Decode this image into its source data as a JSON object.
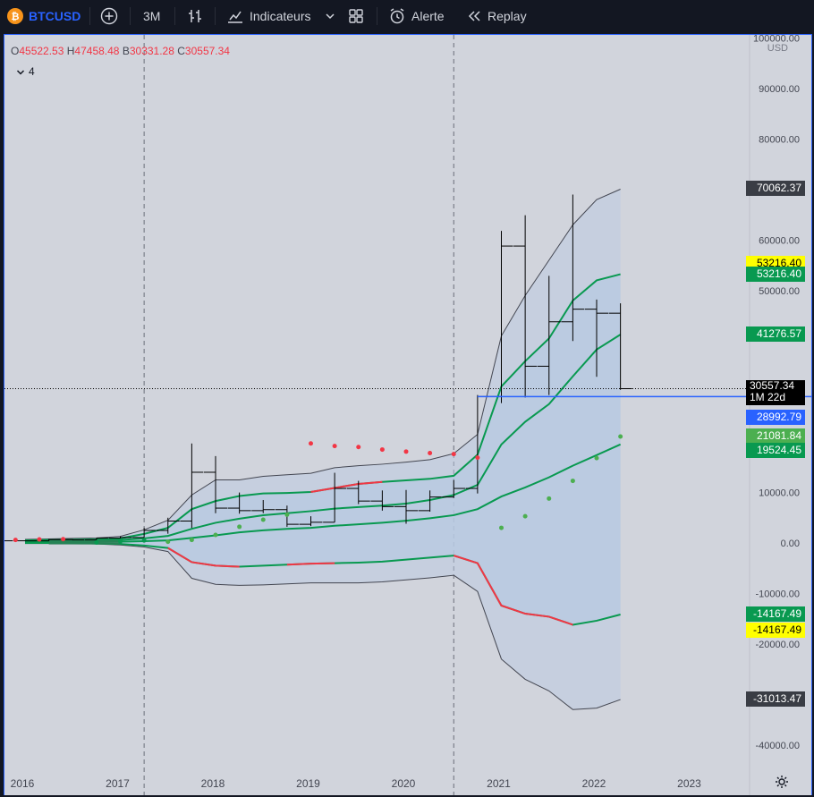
{
  "toolbar": {
    "symbol": "BTCUSD",
    "interval": "3M",
    "indicators_label": "Indicateurs",
    "alert_label": "Alerte",
    "replay_label": "Replay",
    "colors": {
      "bg": "#131722",
      "text": "#d1d4dc",
      "bitcoin": "#f7931a",
      "symbol_text": "#2962ff"
    }
  },
  "legend": {
    "open_key": "O",
    "open": "45522.53",
    "high_key": "H",
    "high": "47458.48",
    "low_key": "B",
    "low": "30331.28",
    "close_key": "C",
    "close": "30557.34",
    "indicators_count": "4"
  },
  "price_axis": {
    "currency": "USD",
    "ticks": [
      {
        "label": "100000.00",
        "v": 100000
      },
      {
        "label": "90000.00",
        "v": 90000
      },
      {
        "label": "80000.00",
        "v": 80000
      },
      {
        "label": "60000.00",
        "v": 60000
      },
      {
        "label": "50000.00",
        "v": 50000
      },
      {
        "label": "10000.00",
        "v": 10000
      },
      {
        "label": "0.00",
        "v": 0
      },
      {
        "label": "-10000.00",
        "v": -10000
      },
      {
        "label": "-20000.00",
        "v": -20000
      },
      {
        "label": "-40000.00",
        "v": -40000
      }
    ],
    "labels": [
      {
        "text": "70062.37",
        "v": 70062.37,
        "bg": "#3a3d45",
        "fg": "#ffffff"
      },
      {
        "text": "53216.40",
        "v": 55200,
        "bg": "#ffff00",
        "fg": "#000000"
      },
      {
        "text": "53216.40",
        "v": 53216.4,
        "bg": "#089950",
        "fg": "#ffffff"
      },
      {
        "text": "41276.57",
        "v": 41276.57,
        "bg": "#089950",
        "fg": "#ffffff"
      },
      {
        "text": "30557.34",
        "v": 30557.34,
        "bg": "#000000",
        "fg": "#ffffff",
        "sub": "1M 22d"
      },
      {
        "text": "28992.79",
        "v": 24800,
        "bg": "#2962ff",
        "fg": "#ffffff"
      },
      {
        "text": "21081.84",
        "v": 21081.84,
        "bg": "#4caf50",
        "fg": "#ffffff"
      },
      {
        "text": "19524.45",
        "v": 18300,
        "bg": "#089950",
        "fg": "#ffffff"
      },
      {
        "text": "-14167.49",
        "v": -14167.49,
        "bg": "#089950",
        "fg": "#ffffff"
      },
      {
        "text": "-14167.49",
        "v": -17300,
        "bg": "#ffff00",
        "fg": "#000000"
      },
      {
        "text": "-31013.47",
        "v": -31013.47,
        "bg": "#3a3d45",
        "fg": "#ffffff"
      }
    ]
  },
  "time_axis": {
    "labels": [
      "2016",
      "2017",
      "2018",
      "2019",
      "2020",
      "2021",
      "2022",
      "2023"
    ]
  },
  "chart_data": {
    "type": "ohlc",
    "interval": "3M",
    "ohlc": [
      {
        "t": 2015.75,
        "o": 230,
        "h": 470,
        "l": 200,
        "c": 430
      },
      {
        "t": 2016.0,
        "o": 430,
        "h": 460,
        "l": 360,
        "c": 415
      },
      {
        "t": 2016.25,
        "o": 415,
        "h": 780,
        "l": 410,
        "c": 670
      },
      {
        "t": 2016.5,
        "o": 670,
        "h": 730,
        "l": 520,
        "c": 610
      },
      {
        "t": 2016.75,
        "o": 610,
        "h": 980,
        "l": 600,
        "c": 960
      },
      {
        "t": 2017.0,
        "o": 960,
        "h": 1300,
        "l": 890,
        "c": 1080
      },
      {
        "t": 2017.25,
        "o": 1080,
        "h": 2980,
        "l": 1080,
        "c": 2480
      },
      {
        "t": 2017.5,
        "o": 2480,
        "h": 5000,
        "l": 1830,
        "c": 4340
      },
      {
        "t": 2017.75,
        "o": 4340,
        "h": 19700,
        "l": 2970,
        "c": 14000
      },
      {
        "t": 2018.0,
        "o": 14000,
        "h": 17200,
        "l": 5900,
        "c": 6900
      },
      {
        "t": 2018.25,
        "o": 6900,
        "h": 9990,
        "l": 5800,
        "c": 6400
      },
      {
        "t": 2018.5,
        "o": 6400,
        "h": 8500,
        "l": 5900,
        "c": 6600
      },
      {
        "t": 2018.75,
        "o": 6600,
        "h": 7400,
        "l": 3200,
        "c": 3700
      },
      {
        "t": 2019.0,
        "o": 3700,
        "h": 5300,
        "l": 3350,
        "c": 4100
      },
      {
        "t": 2019.25,
        "o": 4100,
        "h": 13900,
        "l": 4100,
        "c": 10800
      },
      {
        "t": 2019.5,
        "o": 10800,
        "h": 12300,
        "l": 7700,
        "c": 8300
      },
      {
        "t": 2019.75,
        "o": 8300,
        "h": 10400,
        "l": 6400,
        "c": 7200
      },
      {
        "t": 2020.0,
        "o": 7200,
        "h": 10500,
        "l": 3800,
        "c": 6400
      },
      {
        "t": 2020.25,
        "o": 6400,
        "h": 10400,
        "l": 6200,
        "c": 9100
      },
      {
        "t": 2020.5,
        "o": 9100,
        "h": 12500,
        "l": 8900,
        "c": 10800
      },
      {
        "t": 2020.75,
        "o": 10800,
        "h": 29300,
        "l": 9800,
        "c": 29000
      },
      {
        "t": 2021.0,
        "o": 29000,
        "h": 61800,
        "l": 27700,
        "c": 58800
      },
      {
        "t": 2021.25,
        "o": 58800,
        "h": 64900,
        "l": 28800,
        "c": 35000
      },
      {
        "t": 2021.5,
        "o": 35000,
        "h": 52900,
        "l": 29300,
        "c": 43800
      },
      {
        "t": 2021.75,
        "o": 43800,
        "h": 69000,
        "l": 40000,
        "c": 46300
      },
      {
        "t": 2022.0,
        "o": 46300,
        "h": 48200,
        "l": 32900,
        "c": 45500
      },
      {
        "t": 2022.25,
        "o": 45500,
        "h": 47458.48,
        "l": 30331.28,
        "c": 30557.34
      }
    ],
    "bands": {
      "t": [
        2016.0,
        2016.25,
        2016.5,
        2016.75,
        2017.0,
        2017.25,
        2017.5,
        2017.75,
        2018.0,
        2018.25,
        2018.5,
        2018.75,
        2019.0,
        2019.25,
        2019.5,
        2019.75,
        2020.0,
        2020.25,
        2020.5,
        2020.75,
        2021.0,
        2021.25,
        2021.5,
        2021.75,
        2022.0,
        2022.25
      ],
      "outer_upper": [
        700,
        800,
        900,
        1000,
        1300,
        2600,
        4500,
        9500,
        12500,
        12500,
        13200,
        13500,
        13800,
        14900,
        15300,
        15600,
        16000,
        16500,
        17700,
        21500,
        41000,
        49000,
        56000,
        63000,
        68000,
        70062.37
      ],
      "upper": [
        500,
        600,
        650,
        700,
        900,
        1800,
        3000,
        6700,
        8300,
        9300,
        9800,
        9900,
        10100,
        10900,
        11700,
        12100,
        12400,
        12700,
        13300,
        17500,
        31000,
        36000,
        40500,
        48000,
        52000,
        53216.4
      ],
      "mid": [
        300,
        350,
        400,
        450,
        600,
        900,
        1400,
        2800,
        4000,
        4800,
        5500,
        5900,
        6300,
        6800,
        7100,
        7400,
        7800,
        8500,
        9500,
        11500,
        19500,
        24000,
        27500,
        33000,
        38300,
        41276.57
      ],
      "low_mid": [
        100,
        100,
        150,
        200,
        250,
        350,
        500,
        1000,
        1500,
        2100,
        2500,
        2800,
        3000,
        3400,
        3700,
        4000,
        4400,
        4900,
        5500,
        6700,
        9200,
        11000,
        13000,
        15300,
        17400,
        19524.45
      ],
      "lower": [
        0,
        0,
        0,
        -100,
        -200,
        -500,
        -1000,
        -3800,
        -4500,
        -4700,
        -4500,
        -4300,
        -4100,
        -4000,
        -3900,
        -3700,
        -3300,
        -2900,
        -2500,
        -4000,
        -12400,
        -14000,
        -14600,
        -16200,
        -15400,
        -14167.49
      ],
      "outer_lower": [
        -100,
        -100,
        -100,
        -200,
        -400,
        -800,
        -1700,
        -7000,
        -8200,
        -8400,
        -8300,
        -8100,
        -7900,
        -7900,
        -7900,
        -7700,
        -7300,
        -6900,
        -6400,
        -9600,
        -23000,
        -27000,
        -29300,
        -33000,
        -32700,
        -31013.47
      ],
      "upper_red_segment": [
        "2019.0-2019.75"
      ],
      "lower_red_segment": [
        "2017.5-2018.25",
        "2018.75-2019.25",
        "2020.5-2021.75"
      ]
    },
    "psar_dots": [
      {
        "t": 2015.9,
        "v": 600,
        "c": "#f23645"
      },
      {
        "t": 2016.15,
        "v": 700,
        "c": "#f23645"
      },
      {
        "t": 2016.4,
        "v": 750,
        "c": "#f23645"
      },
      {
        "t": 2016.75,
        "v": 100,
        "c": "#089950"
      },
      {
        "t": 2017.0,
        "v": 300,
        "c": "#089950"
      },
      {
        "t": 2017.25,
        "v": 500,
        "c": "#089950"
      },
      {
        "t": 2017.5,
        "v": 250,
        "c": "#4caf50"
      },
      {
        "t": 2017.75,
        "v": 600,
        "c": "#4caf50"
      },
      {
        "t": 2018.0,
        "v": 1600,
        "c": "#4caf50"
      },
      {
        "t": 2018.25,
        "v": 3200,
        "c": "#4caf50"
      },
      {
        "t": 2018.5,
        "v": 4600,
        "c": "#4caf50"
      },
      {
        "t": 2018.75,
        "v": 5600,
        "c": "#4caf50"
      },
      {
        "t": 2019.0,
        "v": 19700,
        "c": "#f23645"
      },
      {
        "t": 2019.25,
        "v": 19200,
        "c": "#f23645"
      },
      {
        "t": 2019.5,
        "v": 19000,
        "c": "#f23645"
      },
      {
        "t": 2019.75,
        "v": 18500,
        "c": "#f23645"
      },
      {
        "t": 2020.0,
        "v": 18100,
        "c": "#f23645"
      },
      {
        "t": 2020.25,
        "v": 17800,
        "c": "#f23645"
      },
      {
        "t": 2020.5,
        "v": 17600,
        "c": "#f23645"
      },
      {
        "t": 2020.75,
        "v": 16900,
        "c": "#f23645"
      },
      {
        "t": 2021.0,
        "v": 3000,
        "c": "#4caf50"
      },
      {
        "t": 2021.25,
        "v": 5300,
        "c": "#4caf50"
      },
      {
        "t": 2021.5,
        "v": 8800,
        "c": "#4caf50"
      },
      {
        "t": 2021.75,
        "v": 12300,
        "c": "#4caf50"
      },
      {
        "t": 2022.0,
        "v": 16800,
        "c": "#4caf50"
      },
      {
        "t": 2022.25,
        "v": 21081.84,
        "c": "#4caf50"
      }
    ],
    "current_price": 30557.34,
    "blue_line": 28992.79,
    "session_breaks": [
      2017.25,
      2020.5
    ],
    "ylim": [
      -45000,
      100000
    ],
    "xlim": [
      2015.8,
      2023.7
    ]
  }
}
